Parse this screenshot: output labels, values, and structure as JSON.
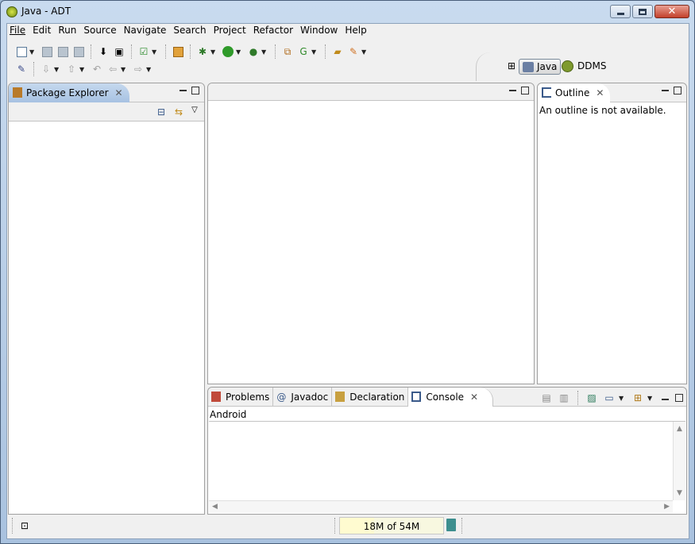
{
  "window": {
    "title": "Java - ADT"
  },
  "menubar": {
    "items": [
      "File",
      "Edit",
      "Run",
      "Source",
      "Navigate",
      "Search",
      "Project",
      "Refactor",
      "Window",
      "Help"
    ]
  },
  "toolbar": {
    "row1_icons": [
      "new-wizard-icon",
      "save-icon",
      "save-all-icon",
      "print-icon",
      "android-sdk-manager-icon",
      "android-avd-manager-icon",
      "lint-check-icon",
      "new-android-project-icon",
      "debug-icon",
      "run-icon",
      "external-tools-icon",
      "new-java-package-icon",
      "new-java-class-icon",
      "open-type-icon",
      "search-icon"
    ],
    "row2_icons": [
      "toggle-mark-occurrences-icon",
      "next-annotation-icon",
      "previous-annotation-icon",
      "last-edit-location-icon",
      "back-icon",
      "forward-icon"
    ]
  },
  "perspectives": {
    "java_label": "Java",
    "ddms_label": "DDMS"
  },
  "package_explorer": {
    "tab_label": "Package Explorer"
  },
  "outline": {
    "tab_label": "Outline",
    "message": "An outline is not available."
  },
  "bottom_panel": {
    "tabs": [
      "Problems",
      "Javadoc",
      "Declaration",
      "Console"
    ],
    "active_tab": "Console",
    "console_name": "Android"
  },
  "statusbar": {
    "heap_text": "18M of 54M",
    "heap_used_fraction": 0.33
  },
  "colors": {
    "active_tab": "#a7c2e2",
    "window_frame": "#c9dbef"
  }
}
